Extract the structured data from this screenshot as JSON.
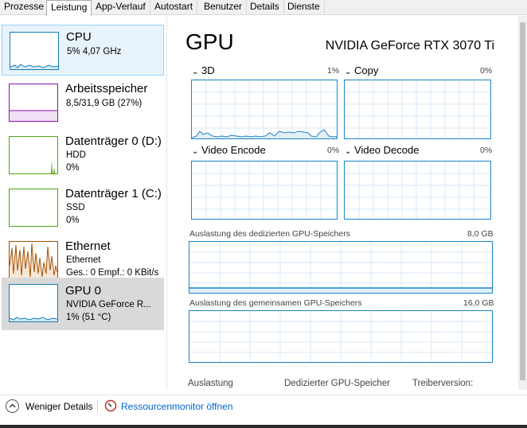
{
  "tabs": [
    "Prozesse",
    "Leistung",
    "App-Verlauf",
    "Autostart",
    "Benutzer",
    "Details",
    "Dienste"
  ],
  "active_tab": "Leistung",
  "sidebar": {
    "items": [
      {
        "title": "CPU",
        "line1": "5%  4,07 GHz",
        "line2": "",
        "line3": "",
        "color": "#117dbb"
      },
      {
        "title": "Arbeitsspeicher",
        "line1": "8,5/31,9 GB (27%)",
        "line2": "",
        "line3": "",
        "color": "#8b12ae"
      },
      {
        "title": "Datenträger 0 (D:)",
        "line1": "HDD",
        "line2": "0%",
        "line3": "",
        "color": "#4da60c"
      },
      {
        "title": "Datenträger 1 (C:)",
        "line1": "SSD",
        "line2": "0%",
        "line3": "",
        "color": "#4da60c"
      },
      {
        "title": "Ethernet",
        "line1": "Ethernet",
        "line2": "Ges.: 0  Empf.: 0 KBit/s",
        "line3": "",
        "color": "#a74f01"
      },
      {
        "title": "GPU 0",
        "line1": "NVIDIA GeForce R...",
        "line2": "1%  (51 °C)",
        "line3": "",
        "color": "#117dbb"
      }
    ]
  },
  "main": {
    "title": "GPU",
    "model": "NVIDIA GeForce RTX 3070 Ti",
    "engines": [
      {
        "name": "3D",
        "pct": "1%"
      },
      {
        "name": "Copy",
        "pct": "0%"
      },
      {
        "name": "Video Encode",
        "pct": "0%"
      },
      {
        "name": "Video Decode",
        "pct": "0%"
      }
    ],
    "dedicated_label": "Auslastung des dedizierten GPU-Speichers",
    "dedicated_max": "8,0 GB",
    "shared_label": "Auslastung des gemeinsamen GPU-Speichers",
    "shared_max": "16,0 GB",
    "bottom": {
      "utilization": "Auslastung",
      "dedicated": "Dedizierter GPU-Speicher",
      "driver": "Treiberversion:"
    }
  },
  "footer": {
    "fewer_details": "Weniger Details",
    "resource_monitor": "Ressourcenmonitor öffnen"
  },
  "colors": {
    "accent": "#1a84c8",
    "selected_cpu_bg": "#e8f3fb",
    "selected_gpu_bg": "#d9d9d9"
  }
}
